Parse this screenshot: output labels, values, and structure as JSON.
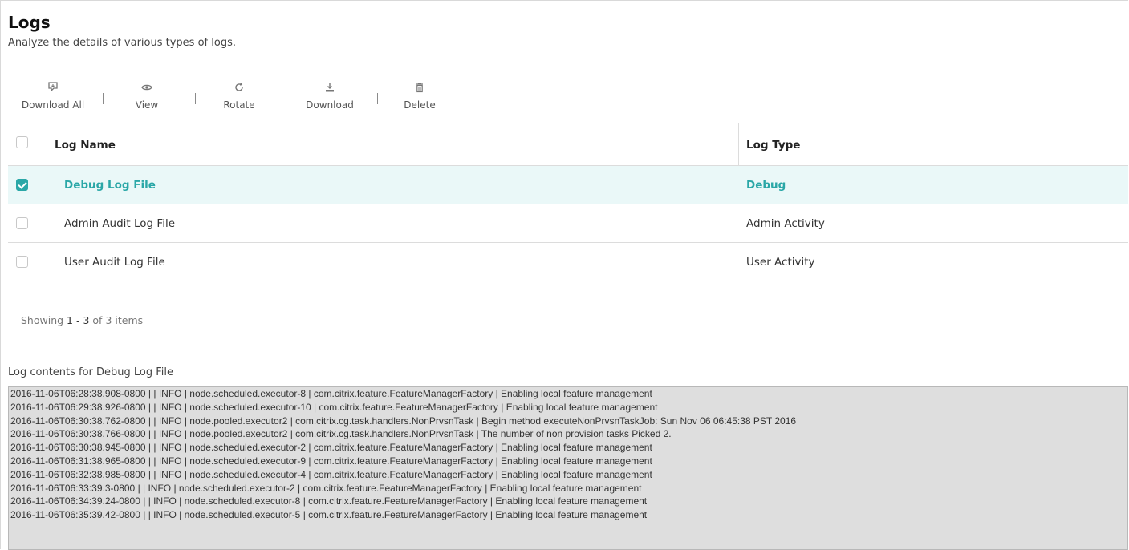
{
  "header": {
    "title": "Logs",
    "subtitle": "Analyze the details of various types of logs."
  },
  "toolbar": {
    "download_all": {
      "label": "Download All",
      "icon": "download-all-icon"
    },
    "view": {
      "label": "View",
      "icon": "eye-icon"
    },
    "rotate": {
      "label": "Rotate",
      "icon": "rotate-icon"
    },
    "download": {
      "label": "Download",
      "icon": "download-icon"
    },
    "delete": {
      "label": "Delete",
      "icon": "trash-icon"
    }
  },
  "table": {
    "columns": {
      "name": "Log Name",
      "type": "Log Type"
    },
    "rows": [
      {
        "name": "Debug Log File",
        "type": "Debug",
        "selected": true
      },
      {
        "name": "Admin Audit Log File",
        "type": "Admin Activity",
        "selected": false
      },
      {
        "name": "User Audit Log File",
        "type": "User Activity",
        "selected": false
      }
    ]
  },
  "pager": {
    "prefix": "Showing",
    "range": "1 - 3",
    "middle": "of",
    "total": "3",
    "suffix": "items"
  },
  "log": {
    "caption": "Log contents for Debug Log File",
    "lines": [
      "2016-11-06T06:28:38.908-0800 |   | INFO | node.scheduled.executor-8 | com.citrix.feature.FeatureManagerFactory | Enabling local feature management",
      "2016-11-06T06:29:38.926-0800 |   | INFO | node.scheduled.executor-10 | com.citrix.feature.FeatureManagerFactory | Enabling local feature management",
      "2016-11-06T06:30:38.762-0800 |   | INFO | node.pooled.executor2 | com.citrix.cg.task.handlers.NonPrvsnTask | Begin method executeNonPrvsnTaskJob: Sun Nov 06 06:45:38 PST 2016",
      "2016-11-06T06:30:38.766-0800 |   | INFO | node.pooled.executor2 | com.citrix.cg.task.handlers.NonPrvsnTask | The number of non provision tasks Picked 2.",
      "2016-11-06T06:30:38.945-0800 |   | INFO | node.scheduled.executor-2 | com.citrix.feature.FeatureManagerFactory | Enabling local feature management",
      "2016-11-06T06:31:38.965-0800 |   | INFO | node.scheduled.executor-9 | com.citrix.feature.FeatureManagerFactory | Enabling local feature management",
      "2016-11-06T06:32:38.985-0800 |   | INFO | node.scheduled.executor-4 | com.citrix.feature.FeatureManagerFactory | Enabling local feature management",
      "2016-11-06T06:33:39.3-0800 |   | INFO | node.scheduled.executor-2 | com.citrix.feature.FeatureManagerFactory | Enabling local feature management",
      "2016-11-06T06:34:39.24-0800 |   | INFO | node.scheduled.executor-8 | com.citrix.feature.FeatureManagerFactory | Enabling local feature management",
      "2016-11-06T06:35:39.42-0800 |   | INFO | node.scheduled.executor-5 | com.citrix.feature.FeatureManagerFactory | Enabling local feature management"
    ]
  },
  "colors": {
    "accent": "#2aa7a7",
    "selected_row": "#eaf8f8",
    "log_bg": "#dedede"
  }
}
